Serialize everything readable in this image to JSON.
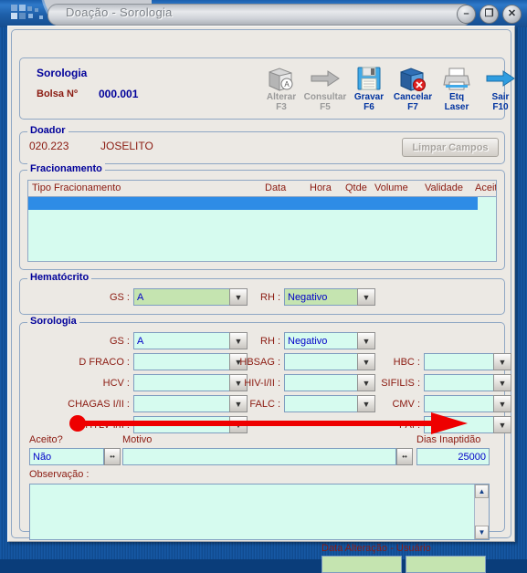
{
  "window": {
    "title": "Doação - Sorologia",
    "controls": {
      "minimize": "–",
      "maximize": "❐",
      "close": "✕"
    },
    "accent_blue": "#00009a",
    "label_red": "#8b1a10",
    "field_mint": "#d6fbef",
    "field_green": "#c5e4b0",
    "annotation_red": "#ee0000"
  },
  "header": {
    "title": "Sorologia",
    "bolsa_label": "Bolsa Nº",
    "bolsa_value": "000.001",
    "toolbar": [
      {
        "label": "Alterar",
        "key": "F3",
        "icon": "alterar-icon",
        "enabled": false
      },
      {
        "label": "Consultar",
        "key": "F5",
        "icon": "consultar-arrow-icon",
        "enabled": false
      },
      {
        "label": "Gravar",
        "key": "F6",
        "icon": "floppy-disk-icon",
        "enabled": true
      },
      {
        "label": "Cancelar",
        "key": "F7",
        "icon": "cancel-folder-icon",
        "enabled": true
      },
      {
        "label": "Etq",
        "key": "Laser",
        "icon": "printer-icon",
        "enabled": true
      },
      {
        "label": "Sair",
        "key": "F10",
        "icon": "exit-arrow-icon",
        "enabled": true
      }
    ]
  },
  "doador": {
    "group_label": "Doador",
    "number": "020.223",
    "name": "JOSELITO",
    "clear_button": "Limpar Campos"
  },
  "fracionamento": {
    "group_label": "Fracionamento",
    "columns": [
      "Tipo Fracionamento",
      "Data",
      "Hora",
      "Qtde",
      "Volume",
      "Validade",
      "Aceito"
    ],
    "rows": []
  },
  "hematocrito": {
    "group_label": "Hematócrito",
    "fields": [
      {
        "label": "GS :",
        "value": "A"
      },
      {
        "label": "RH :",
        "value": "Negativo"
      }
    ]
  },
  "sorologia": {
    "group_label": "Sorologia",
    "row1": [
      {
        "label": "GS :",
        "value": "A"
      },
      {
        "label": "RH :",
        "value": "Negativo"
      }
    ],
    "grid_fields": [
      {
        "label": "D FRACO :",
        "value": ""
      },
      {
        "label": "HBSAG :",
        "value": ""
      },
      {
        "label": "HBC :",
        "value": ""
      },
      {
        "label": "HCV :",
        "value": ""
      },
      {
        "label": "HIV-I/II :",
        "value": ""
      },
      {
        "label": "SIFILIS :",
        "value": ""
      },
      {
        "label": "CHAGAS I/II :",
        "value": ""
      },
      {
        "label": "FALC :",
        "value": ""
      },
      {
        "label": "CMV :",
        "value": ""
      },
      {
        "label": "HTLV-I/II :",
        "value": ""
      },
      {
        "label": "PAI :",
        "value": ""
      }
    ],
    "aceito": {
      "caption": "Aceito?",
      "value": "Não"
    },
    "motivo": {
      "caption": "Motivo",
      "value": ""
    },
    "dias_inaptidao": {
      "caption": "Dias Inaptidão",
      "value": "25000"
    },
    "observacao": {
      "caption": "Observação :",
      "value": ""
    },
    "data_alteracao": {
      "caption": "Data Alteração - Usuário",
      "date_value": "",
      "user_value": ""
    }
  }
}
